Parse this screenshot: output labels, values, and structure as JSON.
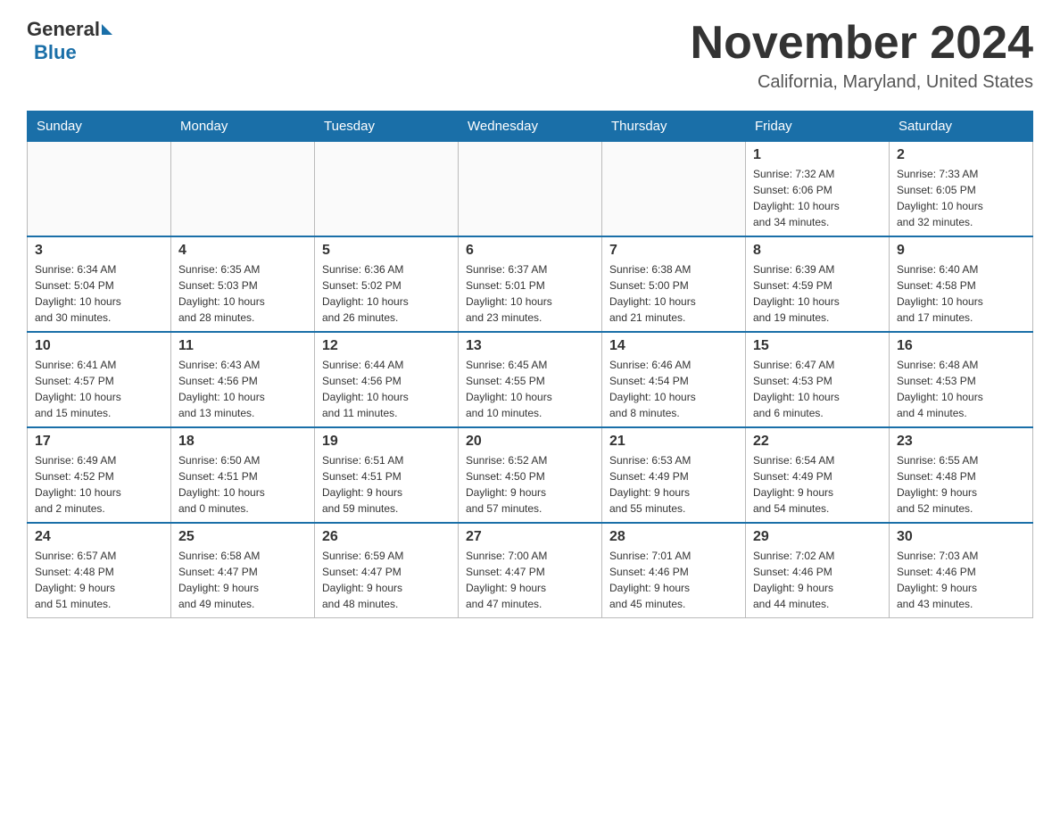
{
  "header": {
    "logo_general": "General",
    "logo_blue": "Blue",
    "title": "November 2024",
    "location": "California, Maryland, United States"
  },
  "days_of_week": [
    "Sunday",
    "Monday",
    "Tuesday",
    "Wednesday",
    "Thursday",
    "Friday",
    "Saturday"
  ],
  "weeks": [
    [
      {
        "day": "",
        "info": ""
      },
      {
        "day": "",
        "info": ""
      },
      {
        "day": "",
        "info": ""
      },
      {
        "day": "",
        "info": ""
      },
      {
        "day": "",
        "info": ""
      },
      {
        "day": "1",
        "info": "Sunrise: 7:32 AM\nSunset: 6:06 PM\nDaylight: 10 hours\nand 34 minutes."
      },
      {
        "day": "2",
        "info": "Sunrise: 7:33 AM\nSunset: 6:05 PM\nDaylight: 10 hours\nand 32 minutes."
      }
    ],
    [
      {
        "day": "3",
        "info": "Sunrise: 6:34 AM\nSunset: 5:04 PM\nDaylight: 10 hours\nand 30 minutes."
      },
      {
        "day": "4",
        "info": "Sunrise: 6:35 AM\nSunset: 5:03 PM\nDaylight: 10 hours\nand 28 minutes."
      },
      {
        "day": "5",
        "info": "Sunrise: 6:36 AM\nSunset: 5:02 PM\nDaylight: 10 hours\nand 26 minutes."
      },
      {
        "day": "6",
        "info": "Sunrise: 6:37 AM\nSunset: 5:01 PM\nDaylight: 10 hours\nand 23 minutes."
      },
      {
        "day": "7",
        "info": "Sunrise: 6:38 AM\nSunset: 5:00 PM\nDaylight: 10 hours\nand 21 minutes."
      },
      {
        "day": "8",
        "info": "Sunrise: 6:39 AM\nSunset: 4:59 PM\nDaylight: 10 hours\nand 19 minutes."
      },
      {
        "day": "9",
        "info": "Sunrise: 6:40 AM\nSunset: 4:58 PM\nDaylight: 10 hours\nand 17 minutes."
      }
    ],
    [
      {
        "day": "10",
        "info": "Sunrise: 6:41 AM\nSunset: 4:57 PM\nDaylight: 10 hours\nand 15 minutes."
      },
      {
        "day": "11",
        "info": "Sunrise: 6:43 AM\nSunset: 4:56 PM\nDaylight: 10 hours\nand 13 minutes."
      },
      {
        "day": "12",
        "info": "Sunrise: 6:44 AM\nSunset: 4:56 PM\nDaylight: 10 hours\nand 11 minutes."
      },
      {
        "day": "13",
        "info": "Sunrise: 6:45 AM\nSunset: 4:55 PM\nDaylight: 10 hours\nand 10 minutes."
      },
      {
        "day": "14",
        "info": "Sunrise: 6:46 AM\nSunset: 4:54 PM\nDaylight: 10 hours\nand 8 minutes."
      },
      {
        "day": "15",
        "info": "Sunrise: 6:47 AM\nSunset: 4:53 PM\nDaylight: 10 hours\nand 6 minutes."
      },
      {
        "day": "16",
        "info": "Sunrise: 6:48 AM\nSunset: 4:53 PM\nDaylight: 10 hours\nand 4 minutes."
      }
    ],
    [
      {
        "day": "17",
        "info": "Sunrise: 6:49 AM\nSunset: 4:52 PM\nDaylight: 10 hours\nand 2 minutes."
      },
      {
        "day": "18",
        "info": "Sunrise: 6:50 AM\nSunset: 4:51 PM\nDaylight: 10 hours\nand 0 minutes."
      },
      {
        "day": "19",
        "info": "Sunrise: 6:51 AM\nSunset: 4:51 PM\nDaylight: 9 hours\nand 59 minutes."
      },
      {
        "day": "20",
        "info": "Sunrise: 6:52 AM\nSunset: 4:50 PM\nDaylight: 9 hours\nand 57 minutes."
      },
      {
        "day": "21",
        "info": "Sunrise: 6:53 AM\nSunset: 4:49 PM\nDaylight: 9 hours\nand 55 minutes."
      },
      {
        "day": "22",
        "info": "Sunrise: 6:54 AM\nSunset: 4:49 PM\nDaylight: 9 hours\nand 54 minutes."
      },
      {
        "day": "23",
        "info": "Sunrise: 6:55 AM\nSunset: 4:48 PM\nDaylight: 9 hours\nand 52 minutes."
      }
    ],
    [
      {
        "day": "24",
        "info": "Sunrise: 6:57 AM\nSunset: 4:48 PM\nDaylight: 9 hours\nand 51 minutes."
      },
      {
        "day": "25",
        "info": "Sunrise: 6:58 AM\nSunset: 4:47 PM\nDaylight: 9 hours\nand 49 minutes."
      },
      {
        "day": "26",
        "info": "Sunrise: 6:59 AM\nSunset: 4:47 PM\nDaylight: 9 hours\nand 48 minutes."
      },
      {
        "day": "27",
        "info": "Sunrise: 7:00 AM\nSunset: 4:47 PM\nDaylight: 9 hours\nand 47 minutes."
      },
      {
        "day": "28",
        "info": "Sunrise: 7:01 AM\nSunset: 4:46 PM\nDaylight: 9 hours\nand 45 minutes."
      },
      {
        "day": "29",
        "info": "Sunrise: 7:02 AM\nSunset: 4:46 PM\nDaylight: 9 hours\nand 44 minutes."
      },
      {
        "day": "30",
        "info": "Sunrise: 7:03 AM\nSunset: 4:46 PM\nDaylight: 9 hours\nand 43 minutes."
      }
    ]
  ]
}
